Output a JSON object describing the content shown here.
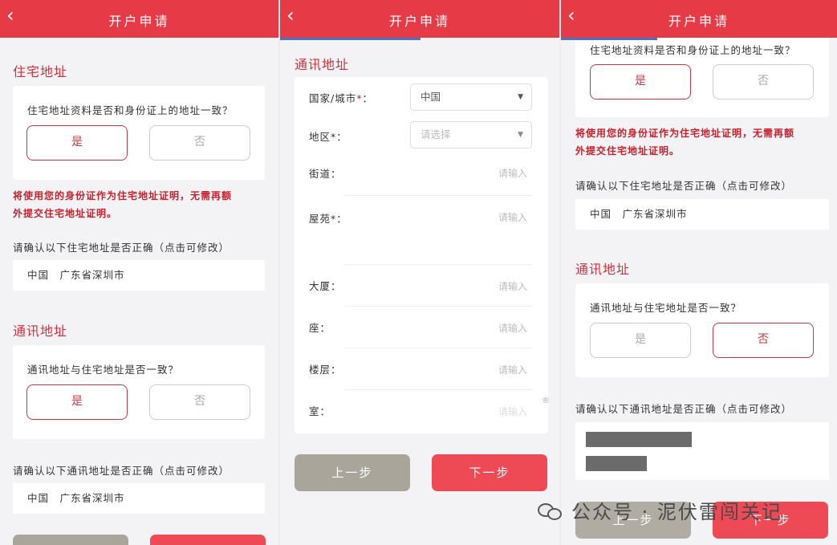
{
  "header": {
    "title": "开户申请",
    "back_glyph": "‹"
  },
  "panel1": {
    "residential": {
      "section_title": "住宅地址",
      "question": "住宅地址资料是否和身份证上的地址一致？",
      "yes": "是",
      "no": "否",
      "note_line1": "将使用您的身份证作为住宅地址证明，无需再额",
      "note_line2": "外提交住宅地址证明。",
      "confirm_label": "请确认以下住宅地址是否正确（点击可修改）",
      "address": "中国　广东省深圳市"
    },
    "mailing": {
      "section_title": "通讯地址",
      "question": "通讯地址与住宅地址是否一致？",
      "yes": "是",
      "no": "否",
      "confirm_label": "请确认以下通讯地址是否正确（点击可修改）",
      "address": "中国　广东省深圳市"
    }
  },
  "panel2": {
    "section_title": "通讯地址",
    "fields": {
      "country_label": "国家/城市",
      "country_value": "中国",
      "region_label": "地区",
      "region_placeholder": "请选择",
      "street_label": "街道：",
      "estate_label": "屋苑",
      "building_label": "大厦：",
      "block_label": "座：",
      "floor_label": "楼层：",
      "room_label": "室：",
      "input_placeholder": "请输入",
      "required_mark": "*",
      "colon": "："
    },
    "prev_button": "上一步",
    "next_button": "下一步",
    "reg_mark": "®"
  },
  "panel3": {
    "question": "住宅地址资料是否和身份证上的地址一致？",
    "yes": "是",
    "no": "否",
    "note_line1": "将使用您的身份证作为住宅地址证明，无需再额",
    "note_line2": "外提交住宅地址证明。",
    "confirm_label": "请确认以下住宅地址是否正确（点击可修改）",
    "address": "中国　广东省深圳市",
    "mailing_title": "通讯地址",
    "mailing_question": "通讯地址与住宅地址是否一致？",
    "mailing_yes": "是",
    "mailing_no": "否",
    "mailing_confirm_label": "请确认以下通讯地址是否正确（点击可修改）",
    "prev_button": "上一步",
    "next_button": "下一步"
  },
  "watermark": "公众号 · 泥伏雷闯关记",
  "colors": {
    "header_red": "#e63b47",
    "accent_red": "#c8202c",
    "button_red": "#ee4a55",
    "button_gray": "#a9a59b",
    "progress_blue": "#4a74b8"
  }
}
